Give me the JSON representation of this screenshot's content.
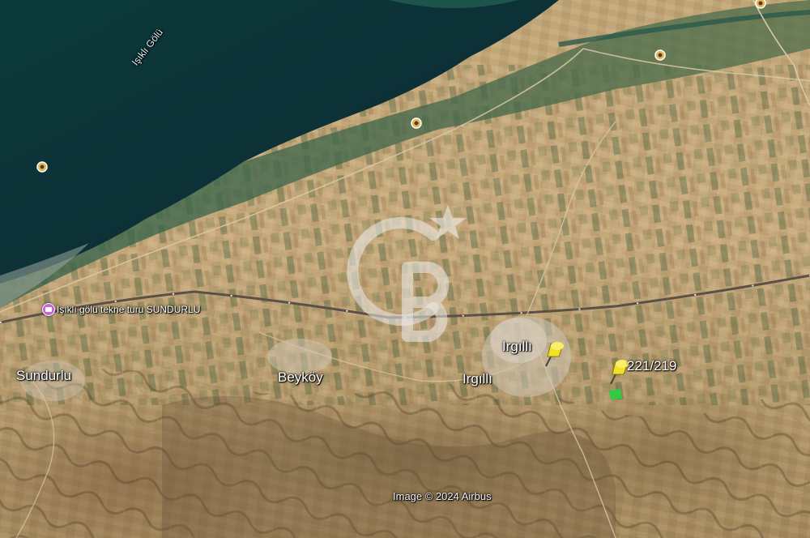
{
  "map": {
    "lake_label": "Işıklı Gölü",
    "towns": {
      "sundurlu": "Sundurlu",
      "beykoy": "Beyköy",
      "irgilli_top": "Irgıllı",
      "irgilli_bottom": "Irgıllı"
    },
    "poi": {
      "label": "Işıklı gölü tekne turu SUNDURLU",
      "icon": "camera-pin-icon"
    },
    "parcel_label": "221/219",
    "attribution": "Image © 2024 Airbus",
    "watermark": "CB logo",
    "colors": {
      "lake": "#0d3a3a",
      "fields": "#c4a777",
      "pin": "#f2e224",
      "parcel_marker": "#2ecc40"
    }
  }
}
